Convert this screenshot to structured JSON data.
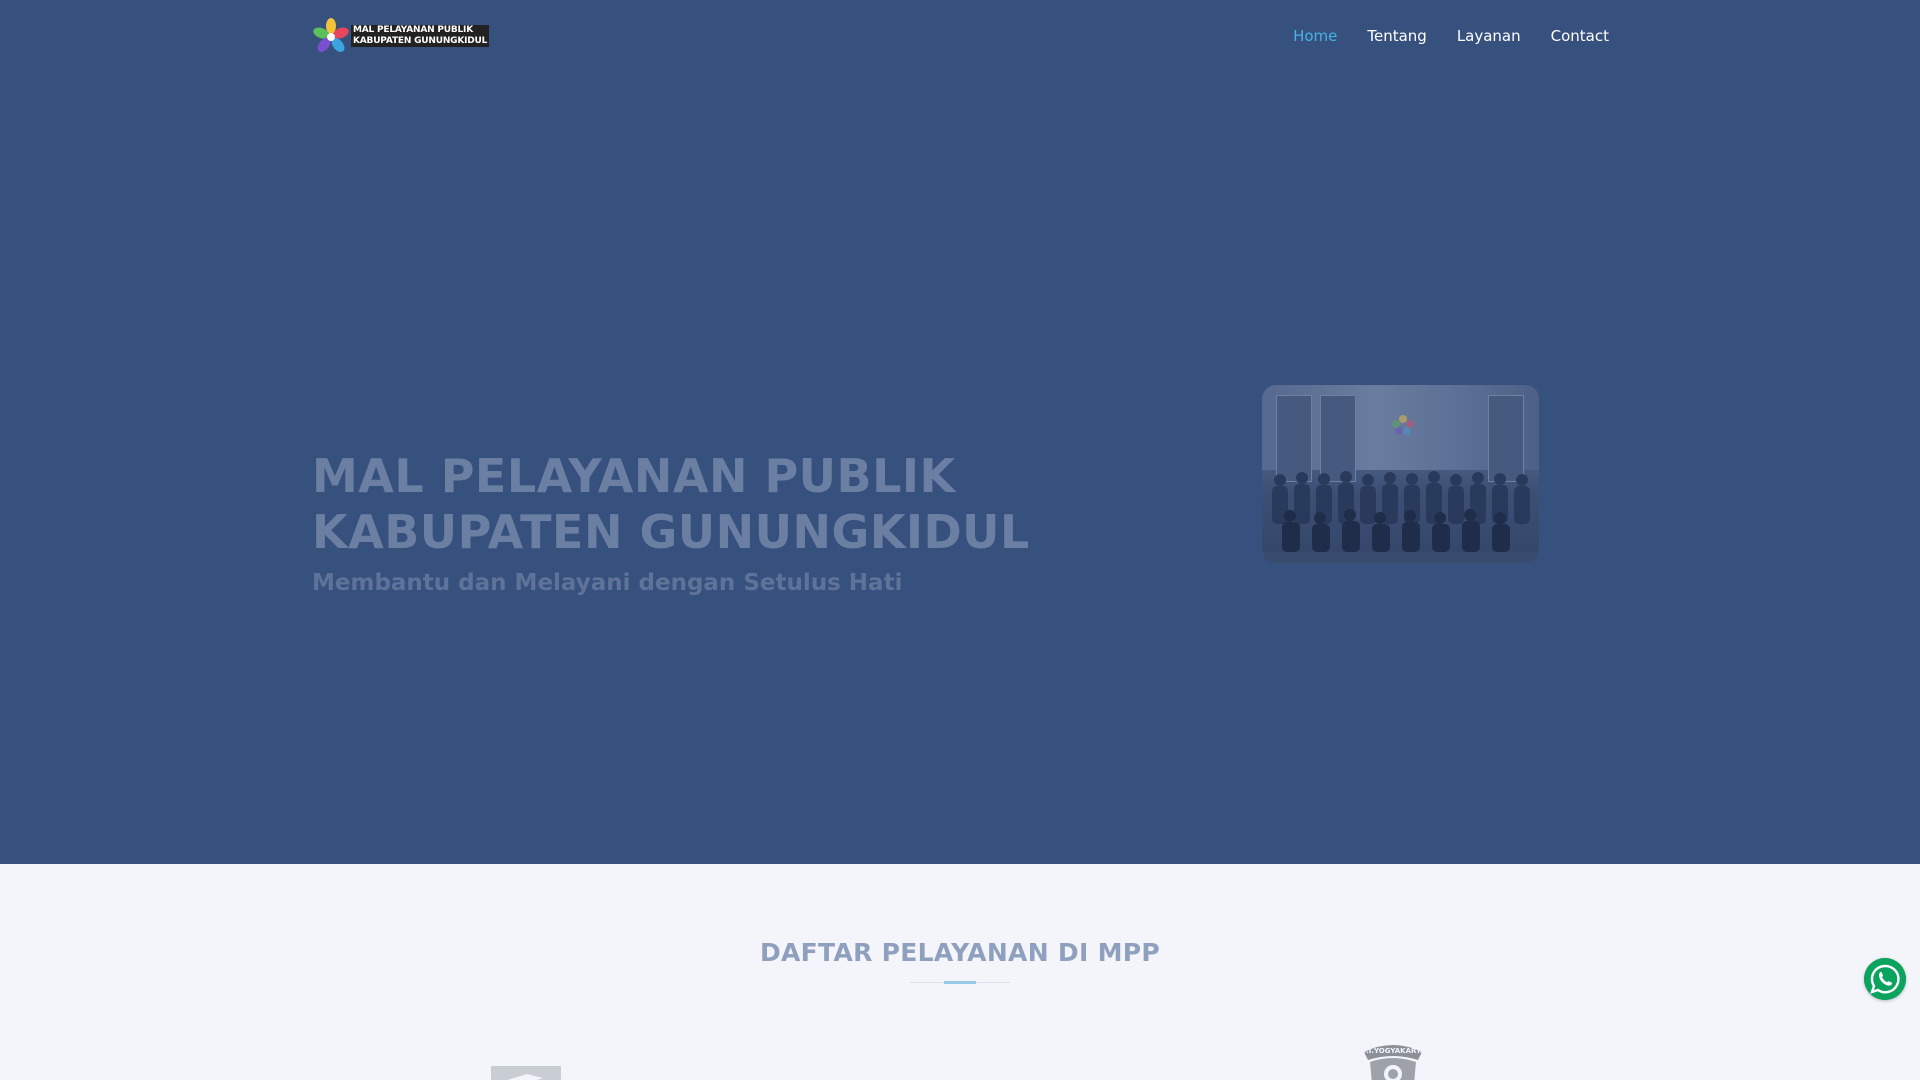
{
  "brand": {
    "logo_line1": "MAL PELAYANAN PUBLIK",
    "logo_line2": "KABUPATEN GUNUNGKIDUL",
    "logo_icon": "colorful-flower-logo-icon"
  },
  "nav": {
    "items": [
      {
        "label": "Home",
        "active": true
      },
      {
        "label": "Tentang",
        "active": false
      },
      {
        "label": "Layanan",
        "active": false
      },
      {
        "label": "Contact",
        "active": false
      }
    ]
  },
  "hero": {
    "title_line1": "MAL PELAYANAN PUBLIK",
    "title_line2": "KABUPATEN GUNUNGKIDUL",
    "subtitle": "Membantu dan Melayani dengan Setulus Hati",
    "image": "group-photo-staff"
  },
  "services": {
    "title": "DAFTAR PELAYANAN DI MPP",
    "logos": [
      "bank-logo-icon",
      "script-logo-icon",
      "emblem-logo-icon",
      "agency-logo-icon",
      "institution-logo-icon",
      "police-badge-icon"
    ],
    "badge_text": "D.I.YOGYAKARTA"
  },
  "whatsapp": {
    "icon": "whatsapp-icon"
  },
  "colors": {
    "hero_bg": "#37517e",
    "nav_active": "#47b2e4",
    "section_bg": "#f3f5fa",
    "whatsapp_green": "#0ba35d"
  }
}
